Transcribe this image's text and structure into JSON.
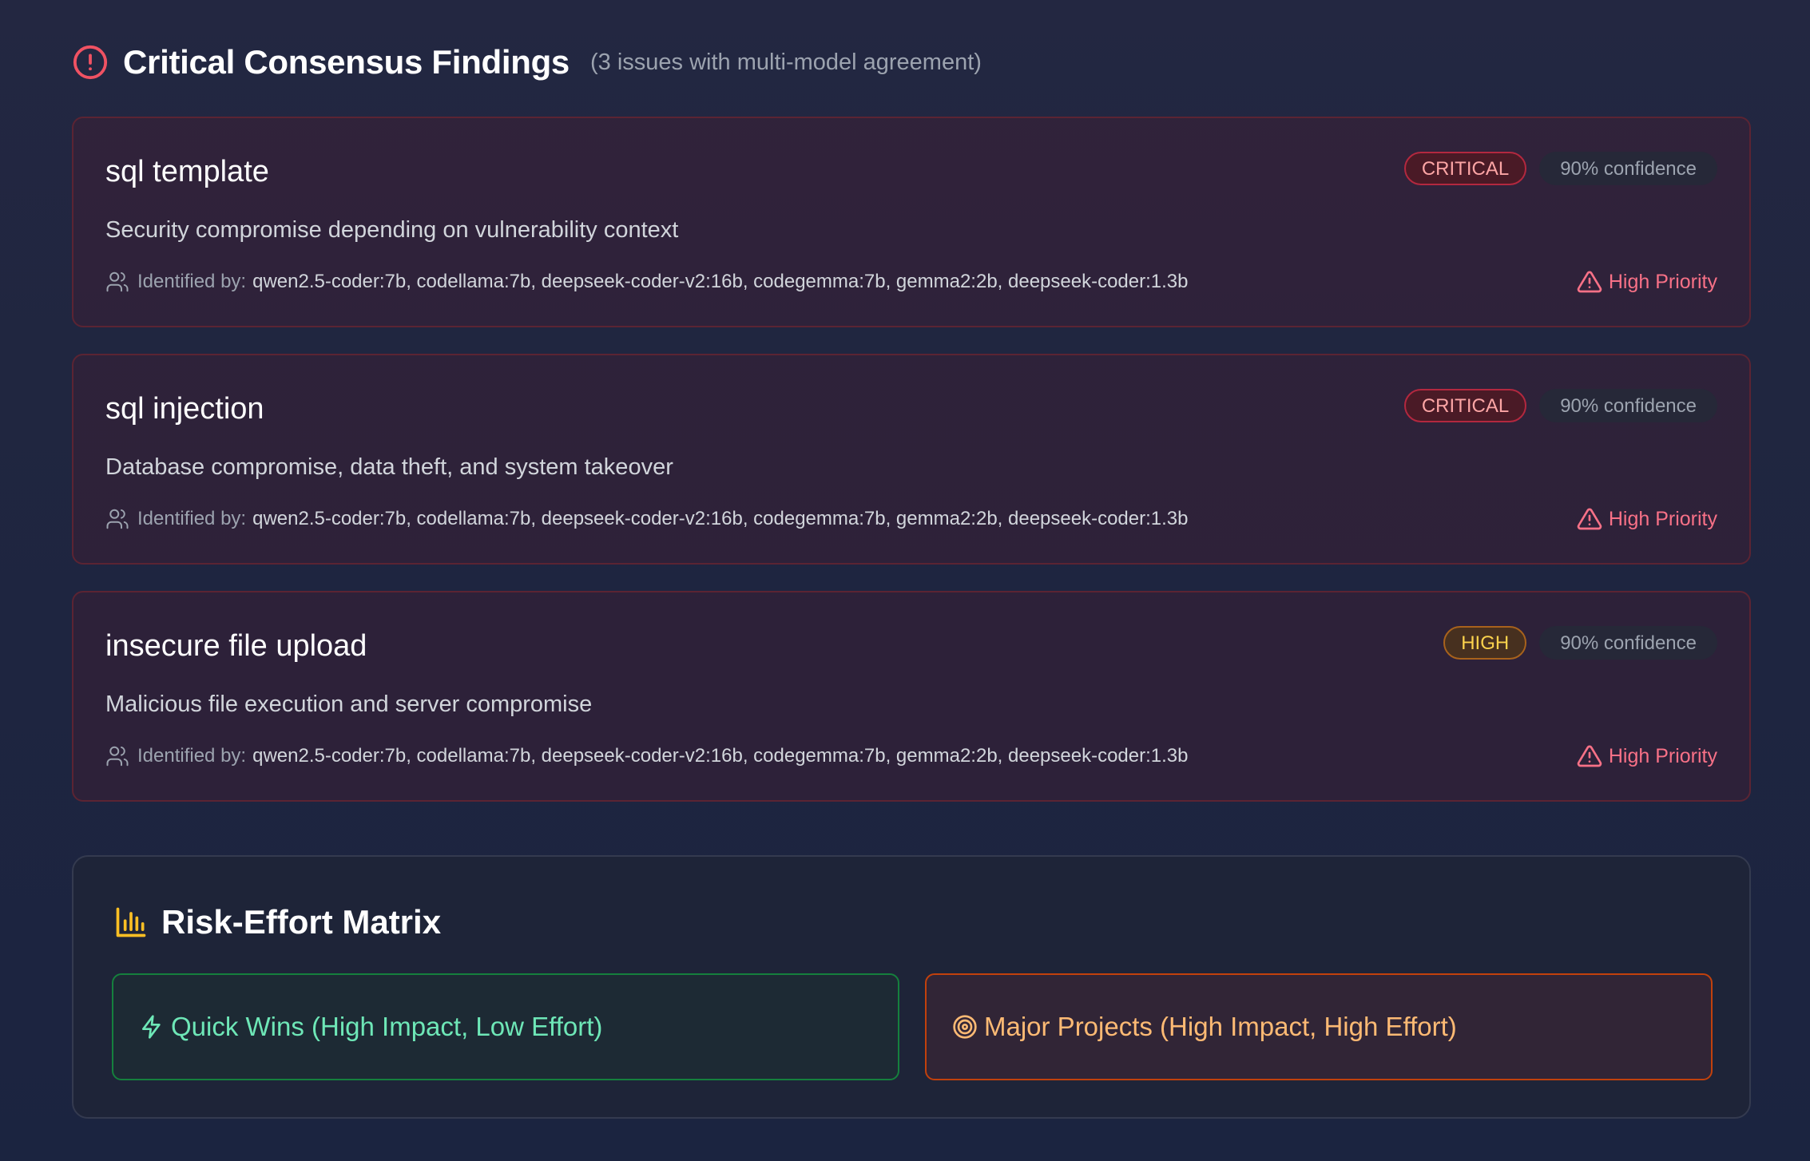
{
  "header": {
    "title": "Critical Consensus Findings",
    "subtitle": "(3 issues with multi-model agreement)",
    "icon": "alert-circle-icon"
  },
  "findings": [
    {
      "title": "sql template",
      "severity": "CRITICAL",
      "confidence": "90% confidence",
      "description": "Security compromise depending on vulnerability context",
      "identified_label": "Identified by:",
      "models": "qwen2.5-coder:7b, codellama:7b, deepseek-coder-v2:16b, codegemma:7b, gemma2:2b, deepseek-coder:1.3b",
      "priority": "High Priority"
    },
    {
      "title": "sql injection",
      "severity": "CRITICAL",
      "confidence": "90% confidence",
      "description": "Database compromise, data theft, and system takeover",
      "identified_label": "Identified by:",
      "models": "qwen2.5-coder:7b, codellama:7b, deepseek-coder-v2:16b, codegemma:7b, gemma2:2b, deepseek-coder:1.3b",
      "priority": "High Priority"
    },
    {
      "title": "insecure file upload",
      "severity": "HIGH",
      "confidence": "90% confidence",
      "description": "Malicious file execution and server compromise",
      "identified_label": "Identified by:",
      "models": "qwen2.5-coder:7b, codellama:7b, deepseek-coder-v2:16b, codegemma:7b, gemma2:2b, deepseek-coder:1.3b",
      "priority": "High Priority"
    }
  ],
  "matrix": {
    "title": "Risk-Effort Matrix",
    "icon": "bar-chart-icon",
    "quadrants": [
      {
        "label": "Quick Wins (High Impact, Low Effort)",
        "icon": "lightning-icon",
        "color": "#6ee7b7"
      },
      {
        "label": "Major Projects (High Impact, High Effort)",
        "icon": "target-icon",
        "color": "#fdba74"
      }
    ]
  },
  "colors": {
    "critical": "#ef4444",
    "high": "#f59e0b",
    "priority": "#f87187",
    "accent_yellow": "#fbbf24"
  }
}
